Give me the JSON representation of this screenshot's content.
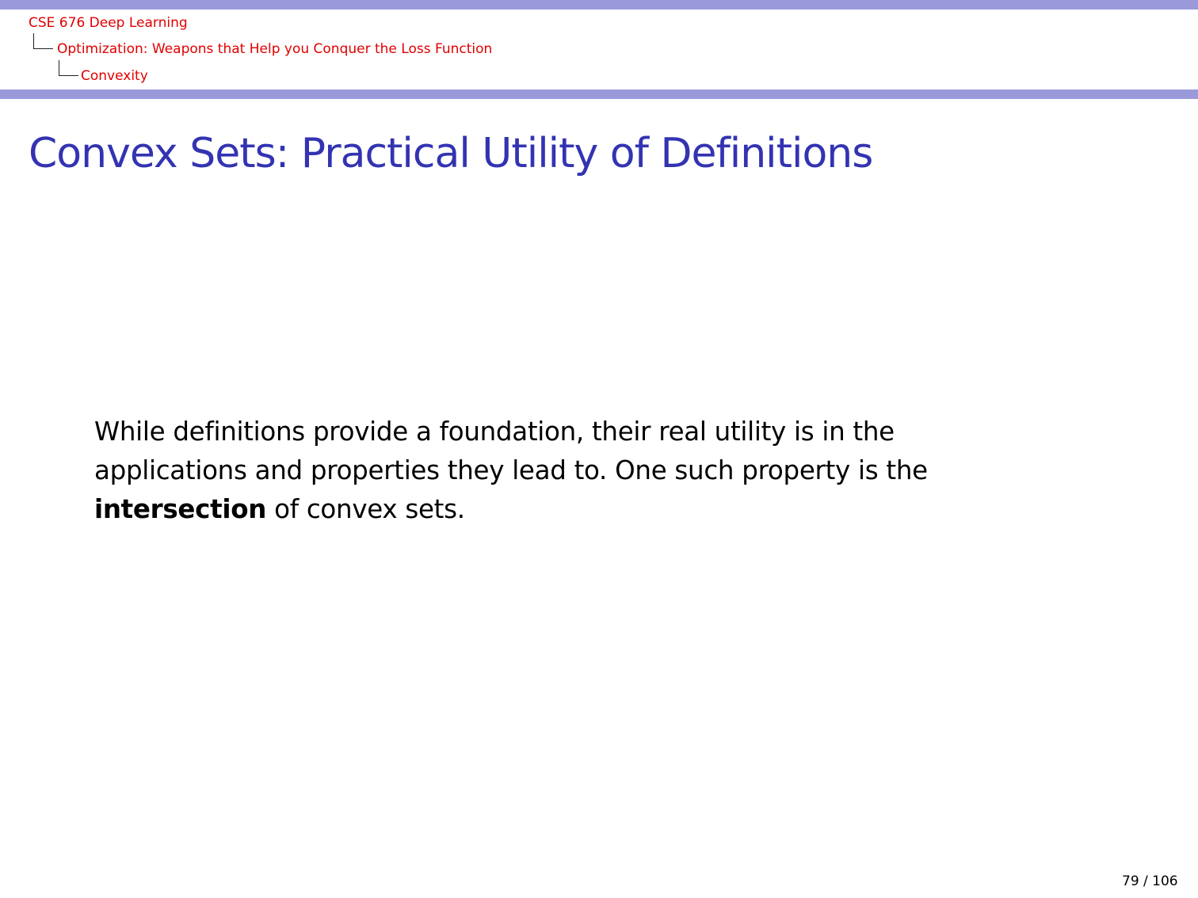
{
  "breadcrumb": {
    "course": "CSE 676 Deep Learning",
    "section": "Optimization: Weapons that Help you Conquer the Loss Function",
    "subsection": "Convexity"
  },
  "slide": {
    "title": "Convex Sets: Practical Utility of Definitions",
    "body_part1": "While definitions provide a foundation, their real utility is in the applications and properties they lead to. One such property is the ",
    "body_bold": "intersection",
    "body_part2": " of convex sets."
  },
  "footer": {
    "page_number": "79 / 106"
  },
  "colors": {
    "header_bar": "#9a9adb",
    "breadcrumb": "#e00000",
    "title": "#3333b2"
  }
}
